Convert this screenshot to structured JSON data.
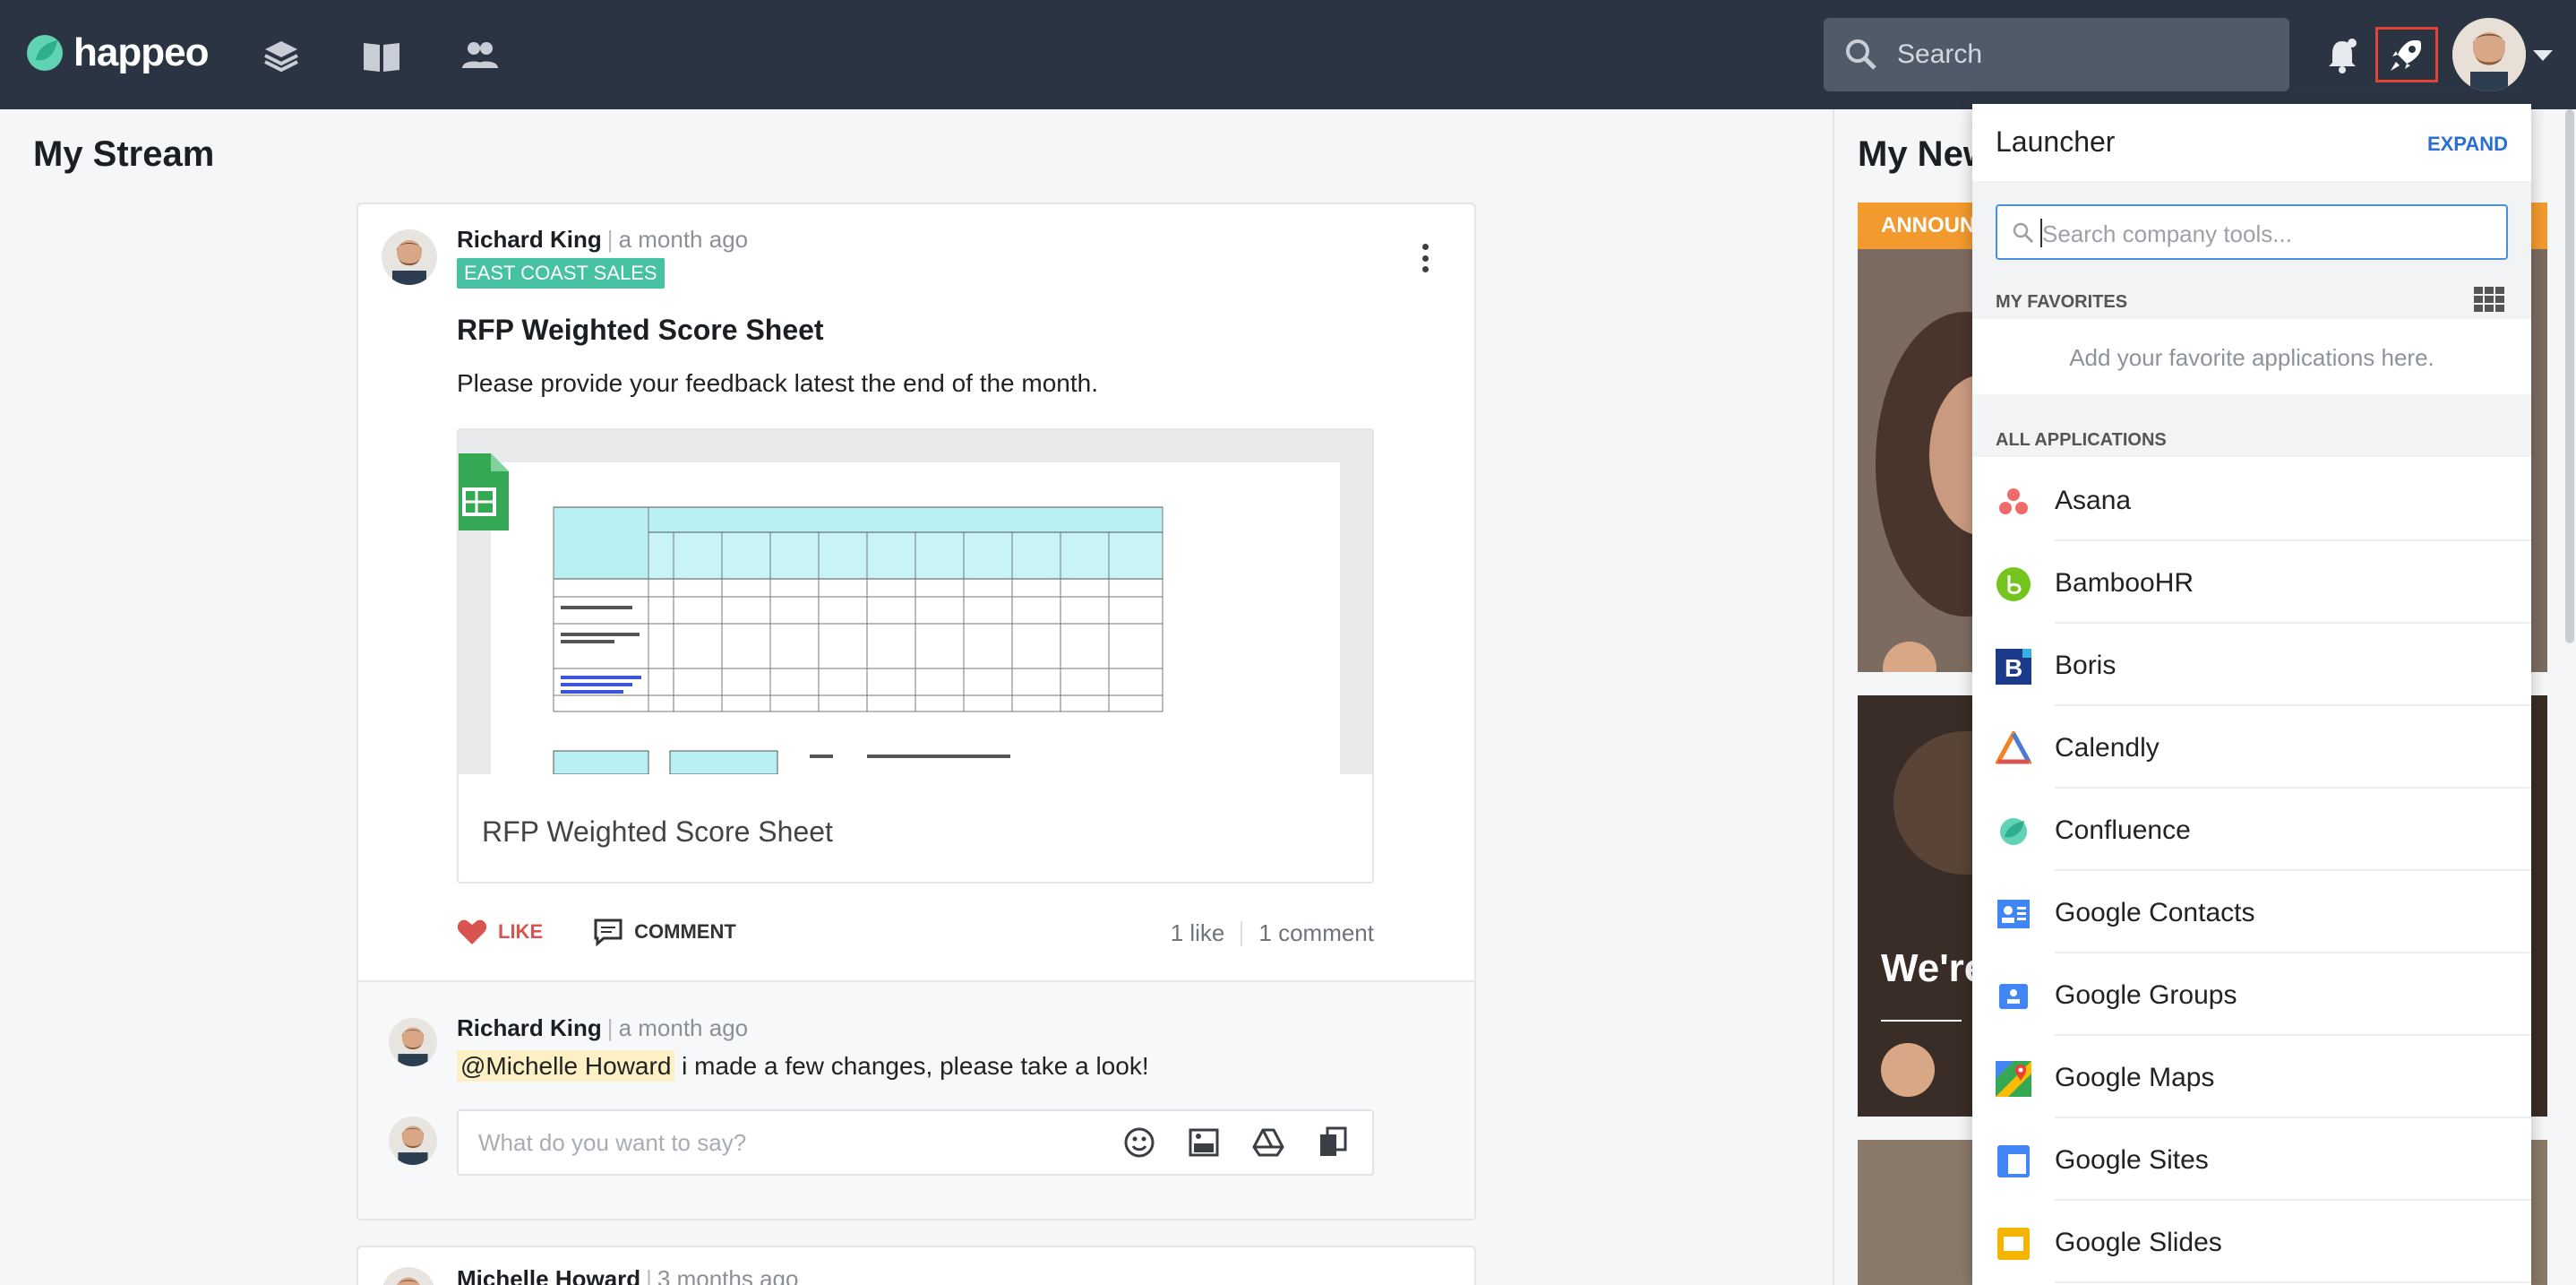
{
  "topbar": {
    "brand": "happeo",
    "search_placeholder": "Search",
    "icons": [
      "layers-icon",
      "book-icon",
      "people-icon",
      "search-icon",
      "bell-icon",
      "rocket-icon",
      "avatar",
      "chevron-down-icon"
    ]
  },
  "stream": {
    "title": "My Stream",
    "post": {
      "author": "Richard King",
      "time": "a month ago",
      "tag": "EAST COAST SALES",
      "title": "RFP Weighted Score Sheet",
      "body": "Please provide your feedback latest the end of the month.",
      "attachment_name": "RFP Weighted Score Sheet",
      "like_label": "LIKE",
      "comment_label": "COMMENT",
      "likes_count": "1 like",
      "comments_count": "1 comment"
    },
    "comment": {
      "author": "Richard King",
      "time": "a month ago",
      "mention": "@Michelle Howard",
      "text": " i made a few changes, please take a look!"
    },
    "compose_placeholder": "What do you want to say?",
    "next_post": {
      "author": "Michelle Howard",
      "time": "3 months ago"
    }
  },
  "news": {
    "title": "My New",
    "label": "ANNOUN",
    "headline": "We're"
  },
  "launcher": {
    "title": "Launcher",
    "expand_label": "EXPAND",
    "search_placeholder": "Search company tools...",
    "favorites_label": "MY FAVORITES",
    "favorites_empty": "Add your favorite applications here.",
    "all_label": "ALL APPLICATIONS",
    "apps": [
      {
        "name": "Asana"
      },
      {
        "name": "BambooHR"
      },
      {
        "name": "Boris"
      },
      {
        "name": "Calendly"
      },
      {
        "name": "Confluence"
      },
      {
        "name": "Google Contacts"
      },
      {
        "name": "Google Groups"
      },
      {
        "name": "Google Maps"
      },
      {
        "name": "Google Sites"
      },
      {
        "name": "Google Slides"
      }
    ]
  },
  "colors": {
    "topbar": "#2b3442",
    "accent_teal": "#47c1a4",
    "like_red": "#d9534f",
    "link_blue": "#2a6fd1",
    "highlight_red": "#e04437",
    "announcement_orange": "#f29a2e"
  }
}
